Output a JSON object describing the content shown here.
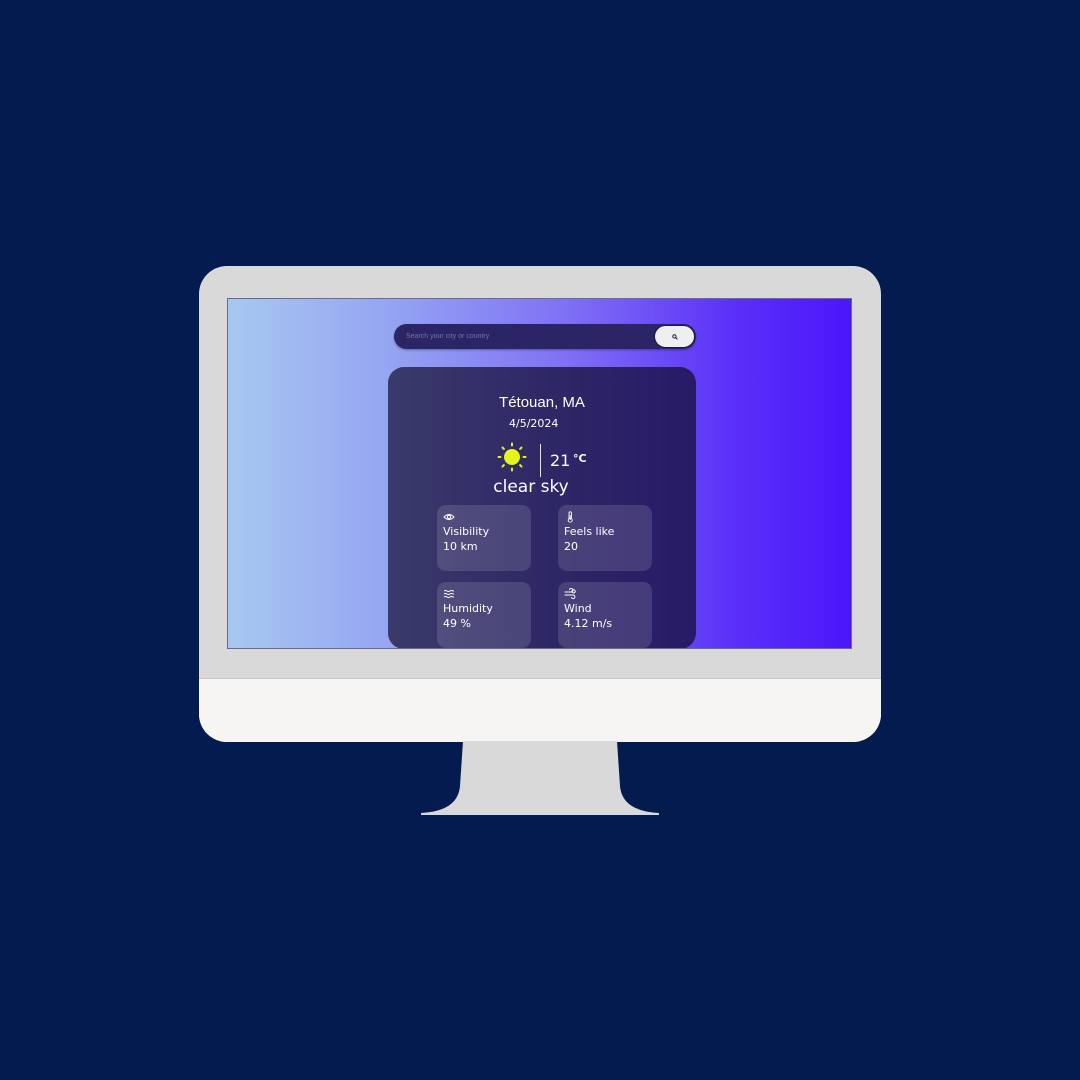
{
  "search": {
    "placeholder": "Search your city or country",
    "button_icon": "search-icon"
  },
  "weather": {
    "city": "Tétouan, MA",
    "date": "4/5/2024",
    "icon": "sun-icon",
    "temperature": "21",
    "unit": "°C",
    "condition": "clear sky"
  },
  "stats": {
    "visibility": {
      "icon": "eye-icon",
      "label": "Visibility",
      "value": "10 km"
    },
    "feels_like": {
      "icon": "thermometer-icon",
      "label": "Feels like",
      "value": "20"
    },
    "humidity": {
      "icon": "humidity-waves-icon",
      "label": "Humidity",
      "value": "49 %"
    },
    "wind": {
      "icon": "wind-icon",
      "label": "Wind",
      "value": "4.12 m/s"
    }
  },
  "colors": {
    "page_background": "#031b4f",
    "bezel": "#d9d9d9",
    "chin": "#f6f5f4",
    "screen_gradient_start": "#a8c8f0",
    "screen_gradient_end": "#4b16fb",
    "card": "#2f2866",
    "sun": "#e3f51a"
  }
}
